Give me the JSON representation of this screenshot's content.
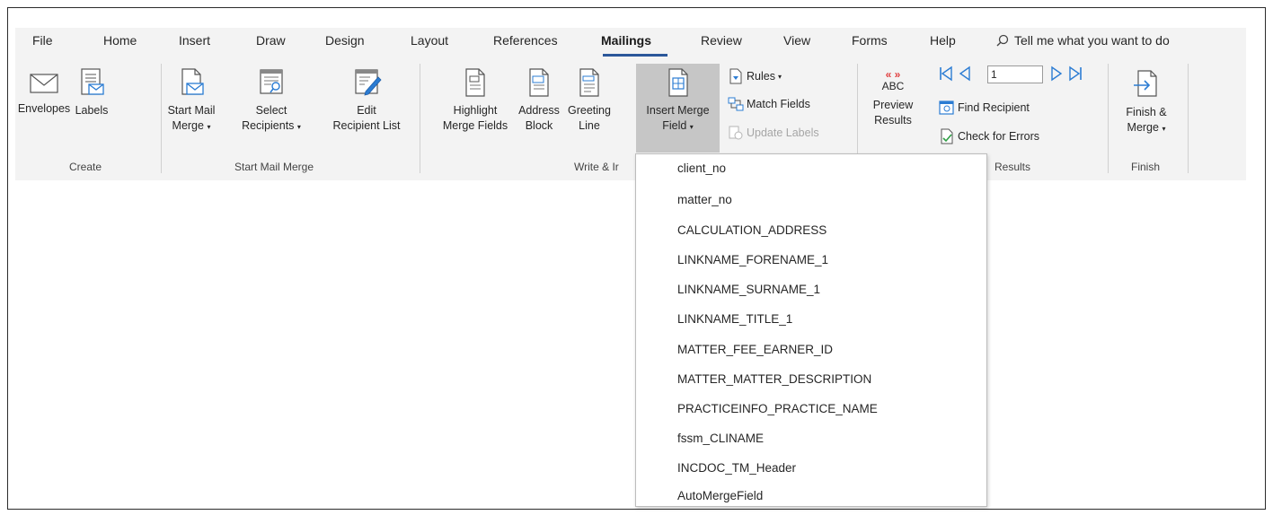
{
  "tabs": [
    "File",
    "Home",
    "Insert",
    "Draw",
    "Design",
    "Layout",
    "References",
    "Mailings",
    "Review",
    "View",
    "Forms",
    "Help"
  ],
  "active_tab": "Mailings",
  "tell_me": "Tell me what you want to do",
  "groups": {
    "create": {
      "label": "Create",
      "envelopes": "Envelopes",
      "labels": "Labels"
    },
    "start_mail_merge": {
      "label": "Start Mail Merge",
      "start_mail_line1": "Start Mail",
      "start_mail_line2": "Merge",
      "select_line1": "Select",
      "select_line2": "Recipients",
      "edit_line1": "Edit",
      "edit_line2": "Recipient List"
    },
    "write_insert": {
      "label": "Write & Ir",
      "highlight_line1": "Highlight",
      "highlight_line2": "Merge Fields",
      "address_line1": "Address",
      "address_line2": "Block",
      "greeting_line1": "Greeting",
      "greeting_line2": "Line",
      "insert_line1": "Insert Merge",
      "insert_line2": "Field",
      "rules": "Rules",
      "match_fields": "Match Fields",
      "update_labels": "Update Labels"
    },
    "preview": {
      "label": "Results",
      "abc": "ABC",
      "preview_line1": "Preview",
      "preview_line2": "Results",
      "record": "1",
      "find_recipient": "Find Recipient",
      "check_errors": "Check for Errors"
    },
    "finish": {
      "label": "Finish",
      "finish_line1": "Finish &",
      "finish_line2": "Merge"
    }
  },
  "merge_fields": [
    "client_no",
    "matter_no",
    "CALCULATION_ADDRESS",
    "LINKNAME_FORENAME_1",
    "LINKNAME_SURNAME_1",
    "LINKNAME_TITLE_1",
    "MATTER_FEE_EARNER_ID",
    "MATTER_MATTER_DESCRIPTION",
    "PRACTICEINFO_PRACTICE_NAME",
    "fssm_CLINAME",
    "INCDOC_TM_Header",
    "AutoMergeField"
  ],
  "colors": {
    "ribbon_bg": "#f3f3f3",
    "accent": "#2b579a",
    "preview_red": "#e03c3c",
    "nav_blue": "#2b7cd3",
    "pressed": "#c6c6c6"
  },
  "icons": [
    "envelope-icon",
    "labels-icon",
    "start-mail-merge-icon",
    "select-recipients-icon",
    "edit-recipient-list-icon",
    "highlight-merge-fields-icon",
    "address-block-icon",
    "greeting-line-icon",
    "insert-merge-field-icon",
    "rules-icon",
    "match-fields-icon",
    "update-labels-icon",
    "preview-results-icon",
    "first-record-icon",
    "previous-record-icon",
    "next-record-icon",
    "last-record-icon",
    "find-recipient-icon",
    "check-errors-icon",
    "finish-merge-icon",
    "search-icon"
  ]
}
